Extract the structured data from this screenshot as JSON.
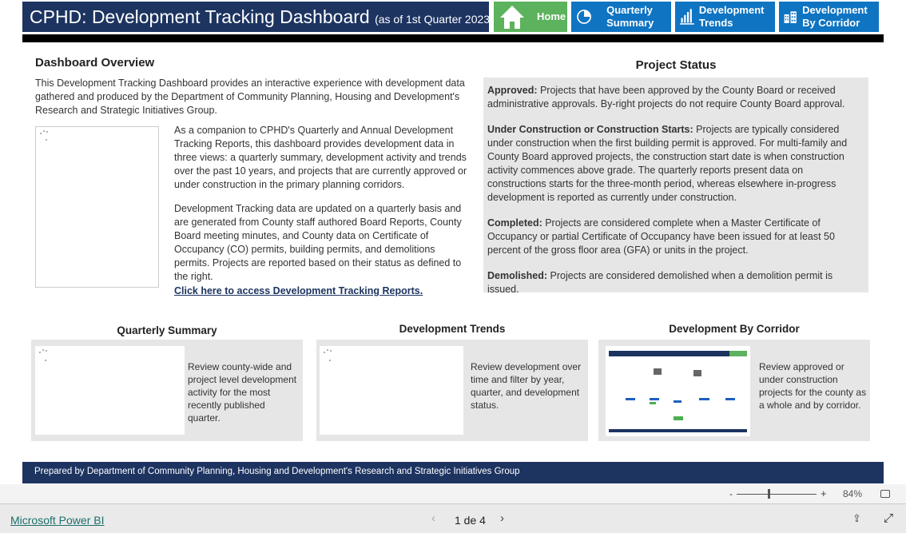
{
  "header": {
    "title": "CPHD: Development Tracking Dashboard",
    "subtitle": "(as of 1st Quarter 2023)"
  },
  "nav": [
    {
      "label": "Home",
      "icon": "home-icon",
      "color": "#5cb25d"
    },
    {
      "label": "Quarterly Summary",
      "icon": "pie-chart-icon",
      "color": "#0f74c2"
    },
    {
      "label": "Development Trends",
      "icon": "bar-chart-icon",
      "color": "#0f74c2"
    },
    {
      "label": "Development By Corridor",
      "icon": "buildings-icon",
      "color": "#0f74c2"
    }
  ],
  "overview": {
    "title": "Dashboard Overview",
    "intro": "This Development Tracking Dashboard provides an interactive experience with development data gathered and produced by the Department of Community Planning, Housing and Development's Research and Strategic Initiatives Group.",
    "p1": "As a companion to CPHD's Quarterly and Annual Development Tracking Reports, this dashboard provides development data in three views: a quarterly summary, development activity and trends over the past 10 years, and projects that are currently approved or under construction in the primary planning corridors.",
    "p2": "Development Tracking data are updated on a quarterly basis and are generated from County staff authored Board Reports, County Board meeting minutes, and County data on Certificate of Occupancy (CO) permits, building permits, and demolitions permits. Projects are reported based on their status as defined to the right.",
    "link": "Click here to access Development Tracking Reports."
  },
  "status": {
    "title": "Project Status",
    "items": [
      {
        "term": "Approved:",
        "text": " Projects that have been approved by the County Board or received administrative approvals.  By-right projects do not require County Board approval."
      },
      {
        "term": "Under Construction or Construction Starts:",
        "text": " Projects are typically considered under construction when the first building permit is approved.  For multi-family and County Board approved projects, the construction start date is when construction activity commences above grade.  The quarterly reports present data on constructions starts for the three-month period, whereas elsewhere in-progress development is reported as currently under construction."
      },
      {
        "term": "Completed:",
        "text": " Projects are considered complete when a Master Certificate of Occupancy or partial Certificate of Occupancy have been issued for at least 50 percent of the gross floor area (GFA) or units in the project."
      },
      {
        "term": "Demolished:",
        "text": " Projects are considered demolished when a demolition permit is issued."
      }
    ]
  },
  "cards": [
    {
      "title": "Quarterly Summary",
      "desc": "Review county-wide and project level development activity for the most recently published quarter."
    },
    {
      "title": "Development Trends",
      "desc": "Review  development over time and filter by year, quarter, and development status."
    },
    {
      "title": "Development By Corridor",
      "desc": "Review approved or under construction projects for the county as a whole and by corridor."
    }
  ],
  "footer": "Prepared by Department of Community Planning, Housing and Development's Research and Strategic Initiatives Group",
  "toolbar": {
    "zoom": "84%",
    "zoom_level": 84
  },
  "bottom": {
    "brand": "Microsoft Power BI",
    "page": "1 de 4"
  }
}
